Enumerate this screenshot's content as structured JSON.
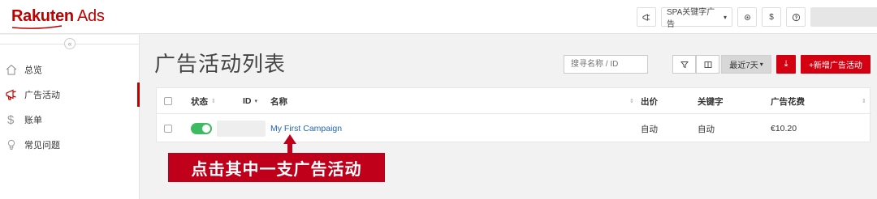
{
  "app": {
    "brand": "Rakuten",
    "product": "Ads"
  },
  "topbar": {
    "account_label": "SPA关键字广告",
    "dropdown_caret": "▾",
    "currency_symbol": "$"
  },
  "sidebar": {
    "collapse_glyph": "«",
    "items": [
      {
        "label": "总览",
        "icon": "home-icon"
      },
      {
        "label": "广告活动",
        "icon": "megaphone-icon"
      },
      {
        "label": "账单",
        "icon": "dollar-icon"
      },
      {
        "label": "常见问题",
        "icon": "lightbulb-icon"
      }
    ],
    "active_item": "广告活动"
  },
  "page": {
    "title": "广告活动列表",
    "search_placeholder": "搜寻名称 / ID",
    "date_range_label": "最近7天",
    "date_range_caret": "▾",
    "download_glyph": "⤓",
    "new_campaign_label": "+新增广告活动"
  },
  "table": {
    "headers": {
      "status": "状态",
      "id": "ID",
      "name": "名称",
      "bid": "出价",
      "keywords": "关键字",
      "spend": "广告花费"
    },
    "sort_glyph": "⇕",
    "id_sort_glyph": "▾",
    "rows": [
      {
        "status_on": true,
        "name": "My First Campaign",
        "bid": "自动",
        "keywords": "自动",
        "spend": "€10.20"
      }
    ]
  },
  "annotation": {
    "callout_text": "点击其中一支广告活动"
  },
  "colors": {
    "brand_red": "#bf0000",
    "button_red": "#d30012",
    "toggle_green": "#3dbb61",
    "link_blue": "#2366b8",
    "callout_red": "#c0001a"
  }
}
